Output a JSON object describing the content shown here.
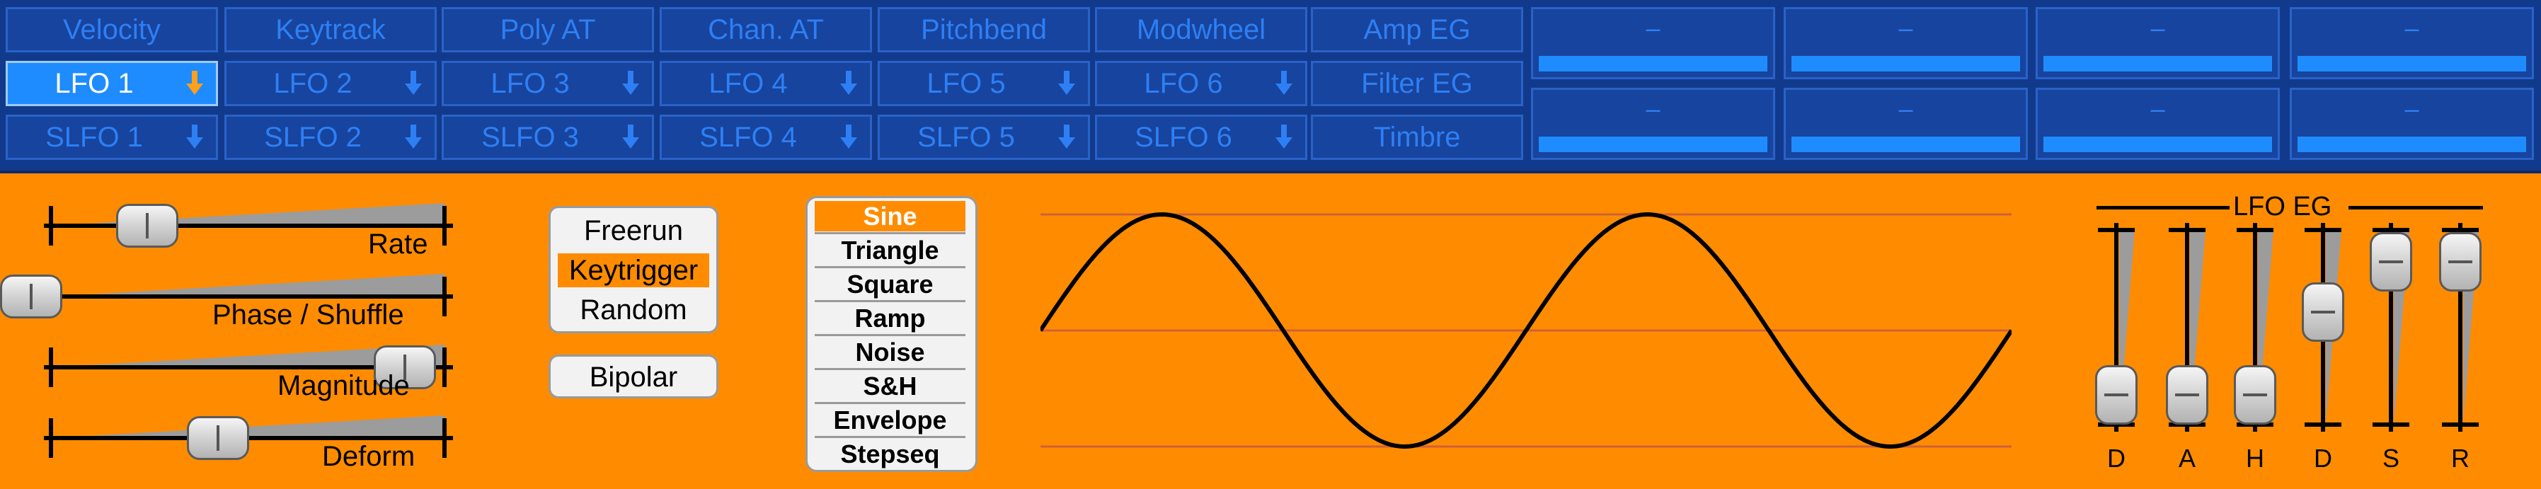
{
  "mod_sources": {
    "rows": [
      [
        {
          "label": "Velocity",
          "arrow": false,
          "selected": false
        },
        {
          "label": "Keytrack",
          "arrow": false,
          "selected": false
        },
        {
          "label": "Poly AT",
          "arrow": false,
          "selected": false
        },
        {
          "label": "Chan. AT",
          "arrow": false,
          "selected": false
        },
        {
          "label": "Pitchbend",
          "arrow": false,
          "selected": false
        },
        {
          "label": "Modwheel",
          "arrow": false,
          "selected": false
        },
        {
          "label": "Amp EG",
          "arrow": false,
          "selected": false
        }
      ],
      [
        {
          "label": "LFO 1",
          "arrow": true,
          "selected": true
        },
        {
          "label": "LFO 2",
          "arrow": true,
          "selected": false
        },
        {
          "label": "LFO 3",
          "arrow": true,
          "selected": false
        },
        {
          "label": "LFO 4",
          "arrow": true,
          "selected": false
        },
        {
          "label": "LFO 5",
          "arrow": true,
          "selected": false
        },
        {
          "label": "LFO 6",
          "arrow": true,
          "selected": false
        },
        {
          "label": "Filter EG",
          "arrow": false,
          "selected": false
        }
      ],
      [
        {
          "label": "SLFO 1",
          "arrow": true,
          "selected": false
        },
        {
          "label": "SLFO 2",
          "arrow": true,
          "selected": false
        },
        {
          "label": "SLFO 3",
          "arrow": true,
          "selected": false
        },
        {
          "label": "SLFO 4",
          "arrow": true,
          "selected": false
        },
        {
          "label": "SLFO 5",
          "arrow": true,
          "selected": false
        },
        {
          "label": "SLFO 6",
          "arrow": true,
          "selected": false
        },
        {
          "label": "Timbre",
          "arrow": false,
          "selected": false
        }
      ]
    ],
    "controllers": [
      [
        {
          "label": "–",
          "level": 1
        },
        {
          "label": "–",
          "level": 1
        },
        {
          "label": "–",
          "level": 1
        },
        {
          "label": "–",
          "level": 1
        }
      ],
      [
        {
          "label": "–",
          "level": 1
        },
        {
          "label": "–",
          "level": 1
        },
        {
          "label": "–",
          "level": 1
        },
        {
          "label": "–",
          "level": 1
        }
      ]
    ]
  },
  "lfo": {
    "sliders": [
      {
        "id": "rate",
        "label": "Rate",
        "value": 0.31
      },
      {
        "id": "phase",
        "label": "Phase / Shuffle",
        "value": 0.0
      },
      {
        "id": "magnitude",
        "label": "Magnitude",
        "value": 1.0
      },
      {
        "id": "deform",
        "label": "Deform",
        "value": 0.5
      }
    ],
    "trigger_modes": [
      "Freerun",
      "Keytrigger",
      "Random"
    ],
    "trigger_selected": "Keytrigger",
    "bipolar_label": "Bipolar",
    "waveforms": [
      "Sine",
      "Triangle",
      "Square",
      "Ramp",
      "Noise",
      "S&H",
      "Envelope",
      "Stepseq"
    ],
    "waveform_selected": "Sine",
    "preview": {
      "shape": "sine",
      "cycles": 2
    }
  },
  "lfo_eg": {
    "title": "LFO EG",
    "stages": [
      {
        "letter": "D",
        "value": 0.0
      },
      {
        "letter": "A",
        "value": 0.0
      },
      {
        "letter": "H",
        "value": 0.0
      },
      {
        "letter": "D",
        "value": 0.62
      },
      {
        "letter": "S",
        "value": 1.0
      },
      {
        "letter": "R",
        "value": 1.0
      }
    ]
  },
  "colors": {
    "panel_orange": "#FF8C00",
    "modbar_bg": "#123A8C",
    "cell_bg": "#17449E",
    "cell_text": "#2E7FF4",
    "selected_blue": "#1E8CFF",
    "arrow_selected": "#FF9F1C"
  }
}
